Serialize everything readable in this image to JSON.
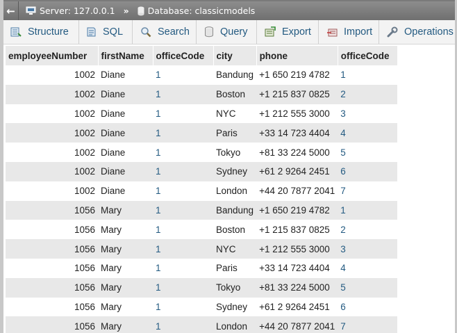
{
  "breadcrumb": {
    "server": "Server: 127.0.0.1",
    "separator": "»",
    "database": "Database: classicmodels"
  },
  "tabs": [
    {
      "label": "Structure",
      "icon": "structure-icon"
    },
    {
      "label": "SQL",
      "icon": "sql-icon"
    },
    {
      "label": "Search",
      "icon": "search-icon"
    },
    {
      "label": "Query",
      "icon": "query-icon"
    },
    {
      "label": "Export",
      "icon": "export-icon"
    },
    {
      "label": "Import",
      "icon": "import-icon"
    },
    {
      "label": "Operations",
      "icon": "wrench-icon"
    }
  ],
  "table": {
    "headers": [
      "employeeNumber",
      "firstName",
      "officeCode",
      "city",
      "phone",
      "officeCode"
    ],
    "rows": [
      [
        "1002",
        "Diane",
        "1",
        "Bandung",
        "+1 650 219 4782",
        "1"
      ],
      [
        "1002",
        "Diane",
        "1",
        "Boston",
        "+1 215 837 0825",
        "2"
      ],
      [
        "1002",
        "Diane",
        "1",
        "NYC",
        "+1 212 555 3000",
        "3"
      ],
      [
        "1002",
        "Diane",
        "1",
        "Paris",
        "+33 14 723 4404",
        "4"
      ],
      [
        "1002",
        "Diane",
        "1",
        "Tokyo",
        "+81 33 224 5000",
        "5"
      ],
      [
        "1002",
        "Diane",
        "1",
        "Sydney",
        "+61 2 9264 2451",
        "6"
      ],
      [
        "1002",
        "Diane",
        "1",
        "London",
        "+44 20 7877 2041",
        "7"
      ],
      [
        "1056",
        "Mary",
        "1",
        "Bandung",
        "+1 650 219 4782",
        "1"
      ],
      [
        "1056",
        "Mary",
        "1",
        "Boston",
        "+1 215 837 0825",
        "2"
      ],
      [
        "1056",
        "Mary",
        "1",
        "NYC",
        "+1 212 555 3000",
        "3"
      ],
      [
        "1056",
        "Mary",
        "1",
        "Paris",
        "+33 14 723 4404",
        "4"
      ],
      [
        "1056",
        "Mary",
        "1",
        "Tokyo",
        "+81 33 224 5000",
        "5"
      ],
      [
        "1056",
        "Mary",
        "1",
        "Sydney",
        "+61 2 9264 2451",
        "6"
      ],
      [
        "1056",
        "Mary",
        "1",
        "London",
        "+44 20 7877 2041",
        "7"
      ]
    ]
  },
  "colors": {
    "link": "#235a81",
    "row_alt": "#e8e8e8",
    "header_bg": "#e9e9e9"
  }
}
